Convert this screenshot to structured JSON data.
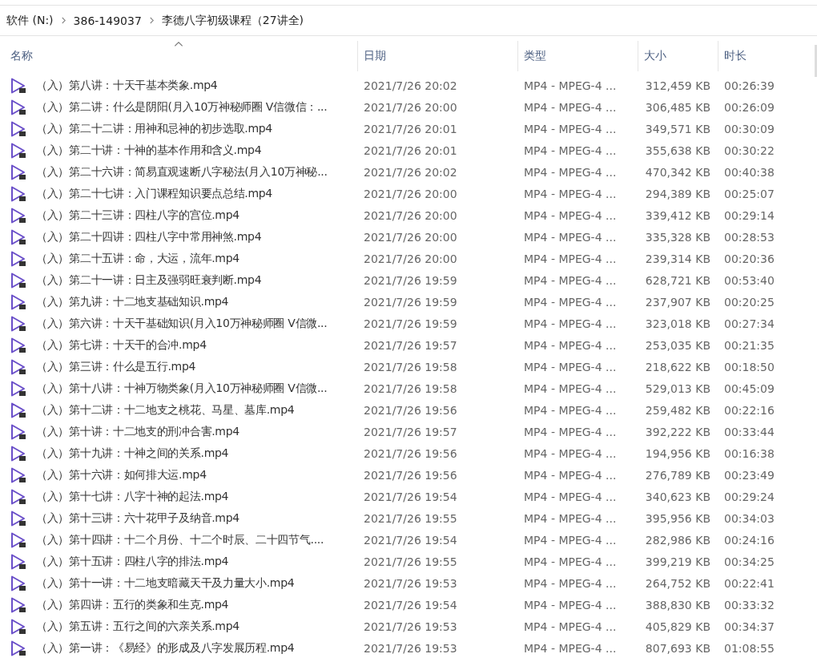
{
  "breadcrumb": [
    "软件 (N:)",
    "386-149037",
    "李德八字初级课程（27讲全)"
  ],
  "columns": [
    {
      "label": "名称",
      "sorted": true,
      "kind": "name"
    },
    {
      "label": "日期",
      "sorted": false,
      "kind": "date"
    },
    {
      "label": "类型",
      "sorted": false,
      "kind": "type"
    },
    {
      "label": "大小",
      "sorted": false,
      "kind": "size"
    },
    {
      "label": "时长",
      "sorted": false,
      "kind": "duration"
    }
  ],
  "rows": [
    {
      "name": "（入）第八讲：十天干基本类象.mp4",
      "date": "2021/7/26 20:02",
      "type": "MP4 - MPEG-4 ...",
      "size": "312,459 KB",
      "duration": "00:26:39"
    },
    {
      "name": "（入）第二讲：什么是阴阳(月入10万神秘师圈 V信微信：...",
      "date": "2021/7/26 20:00",
      "type": "MP4 - MPEG-4 ...",
      "size": "306,485 KB",
      "duration": "00:26:09"
    },
    {
      "name": "（入）第二十二讲：用神和忌神的初步选取.mp4",
      "date": "2021/7/26 20:01",
      "type": "MP4 - MPEG-4 ...",
      "size": "349,571 KB",
      "duration": "00:30:09"
    },
    {
      "name": "（入）第二十讲：十神的基本作用和含义.mp4",
      "date": "2021/7/26 20:01",
      "type": "MP4 - MPEG-4 ...",
      "size": "355,638 KB",
      "duration": "00:30:22"
    },
    {
      "name": "（入）第二十六讲：简易直观速断八字秘法(月入10万神秘...",
      "date": "2021/7/26 20:02",
      "type": "MP4 - MPEG-4 ...",
      "size": "470,342 KB",
      "duration": "00:40:38"
    },
    {
      "name": "（入）第二十七讲：入门课程知识要点总结.mp4",
      "date": "2021/7/26 20:00",
      "type": "MP4 - MPEG-4 ...",
      "size": "294,389 KB",
      "duration": "00:25:07"
    },
    {
      "name": "（入）第二十三讲：四柱八字的宫位.mp4",
      "date": "2021/7/26 20:00",
      "type": "MP4 - MPEG-4 ...",
      "size": "339,412 KB",
      "duration": "00:29:14"
    },
    {
      "name": "（入）第二十四讲：四柱八字中常用神煞.mp4",
      "date": "2021/7/26 20:00",
      "type": "MP4 - MPEG-4 ...",
      "size": "335,328 KB",
      "duration": "00:28:53"
    },
    {
      "name": "（入）第二十五讲：命，大运，流年.mp4",
      "date": "2021/7/26 20:00",
      "type": "MP4 - MPEG-4 ...",
      "size": "239,314 KB",
      "duration": "00:20:36"
    },
    {
      "name": "（入）第二十一讲：日主及强弱旺衰判断.mp4",
      "date": "2021/7/26 19:59",
      "type": "MP4 - MPEG-4 ...",
      "size": "628,721 KB",
      "duration": "00:53:40"
    },
    {
      "name": "（入）第九讲：十二地支基础知识.mp4",
      "date": "2021/7/26 19:59",
      "type": "MP4 - MPEG-4 ...",
      "size": "237,907 KB",
      "duration": "00:20:25"
    },
    {
      "name": "（入）第六讲：十天干基础知识(月入10万神秘师圈 V信微...",
      "date": "2021/7/26 19:59",
      "type": "MP4 - MPEG-4 ...",
      "size": "323,018 KB",
      "duration": "00:27:34"
    },
    {
      "name": "（入）第七讲：十天干的合冲.mp4",
      "date": "2021/7/26 19:57",
      "type": "MP4 - MPEG-4 ...",
      "size": "253,035 KB",
      "duration": "00:21:35"
    },
    {
      "name": "（入）第三讲：什么是五行.mp4",
      "date": "2021/7/26 19:58",
      "type": "MP4 - MPEG-4 ...",
      "size": "218,622 KB",
      "duration": "00:18:50"
    },
    {
      "name": "（入）第十八讲：十神万物类象(月入10万神秘师圈 V信微...",
      "date": "2021/7/26 19:58",
      "type": "MP4 - MPEG-4 ...",
      "size": "529,013 KB",
      "duration": "00:45:09"
    },
    {
      "name": "（入）第十二讲：十二地支之桃花、马星、墓库.mp4",
      "date": "2021/7/26 19:56",
      "type": "MP4 - MPEG-4 ...",
      "size": "259,482 KB",
      "duration": "00:22:16"
    },
    {
      "name": "（入）第十讲：十二地支的刑冲合害.mp4",
      "date": "2021/7/26 19:57",
      "type": "MP4 - MPEG-4 ...",
      "size": "392,222 KB",
      "duration": "00:33:44"
    },
    {
      "name": "（入）第十九讲：十神之间的关系.mp4",
      "date": "2021/7/26 19:56",
      "type": "MP4 - MPEG-4 ...",
      "size": "194,956 KB",
      "duration": "00:16:38"
    },
    {
      "name": "（入）第十六讲：如何排大运.mp4",
      "date": "2021/7/26 19:56",
      "type": "MP4 - MPEG-4 ...",
      "size": "276,789 KB",
      "duration": "00:23:49"
    },
    {
      "name": "（入）第十七讲：八字十神的起法.mp4",
      "date": "2021/7/26 19:54",
      "type": "MP4 - MPEG-4 ...",
      "size": "340,623 KB",
      "duration": "00:29:24"
    },
    {
      "name": "（入）第十三讲：六十花甲子及纳音.mp4",
      "date": "2021/7/26 19:55",
      "type": "MP4 - MPEG-4 ...",
      "size": "395,956 KB",
      "duration": "00:34:03"
    },
    {
      "name": "（入）第十四讲：十二个月份、十二个时辰、二十四节气....",
      "date": "2021/7/26 19:54",
      "type": "MP4 - MPEG-4 ...",
      "size": "282,986 KB",
      "duration": "00:24:16"
    },
    {
      "name": "（入）第十五讲：四柱八字的排法.mp4",
      "date": "2021/7/26 19:55",
      "type": "MP4 - MPEG-4 ...",
      "size": "399,219 KB",
      "duration": "00:34:25"
    },
    {
      "name": "（入）第十一讲：十二地支暗藏天干及力量大小.mp4",
      "date": "2021/7/26 19:53",
      "type": "MP4 - MPEG-4 ...",
      "size": "264,752 KB",
      "duration": "00:22:41"
    },
    {
      "name": "（入）第四讲：五行的类象和生克.mp4",
      "date": "2021/7/26 19:54",
      "type": "MP4 - MPEG-4 ...",
      "size": "388,830 KB",
      "duration": "00:33:32"
    },
    {
      "name": "（入）第五讲：五行之间的六亲关系.mp4",
      "date": "2021/7/26 19:53",
      "type": "MP4 - MPEG-4 ...",
      "size": "405,829 KB",
      "duration": "00:34:37"
    },
    {
      "name": "（入）第一讲：《易经》的形成及八字发展历程.mp4",
      "date": "2021/7/26 19:53",
      "type": "MP4 - MPEG-4 ...",
      "size": "807,693 KB",
      "duration": "01:08:55"
    }
  ]
}
